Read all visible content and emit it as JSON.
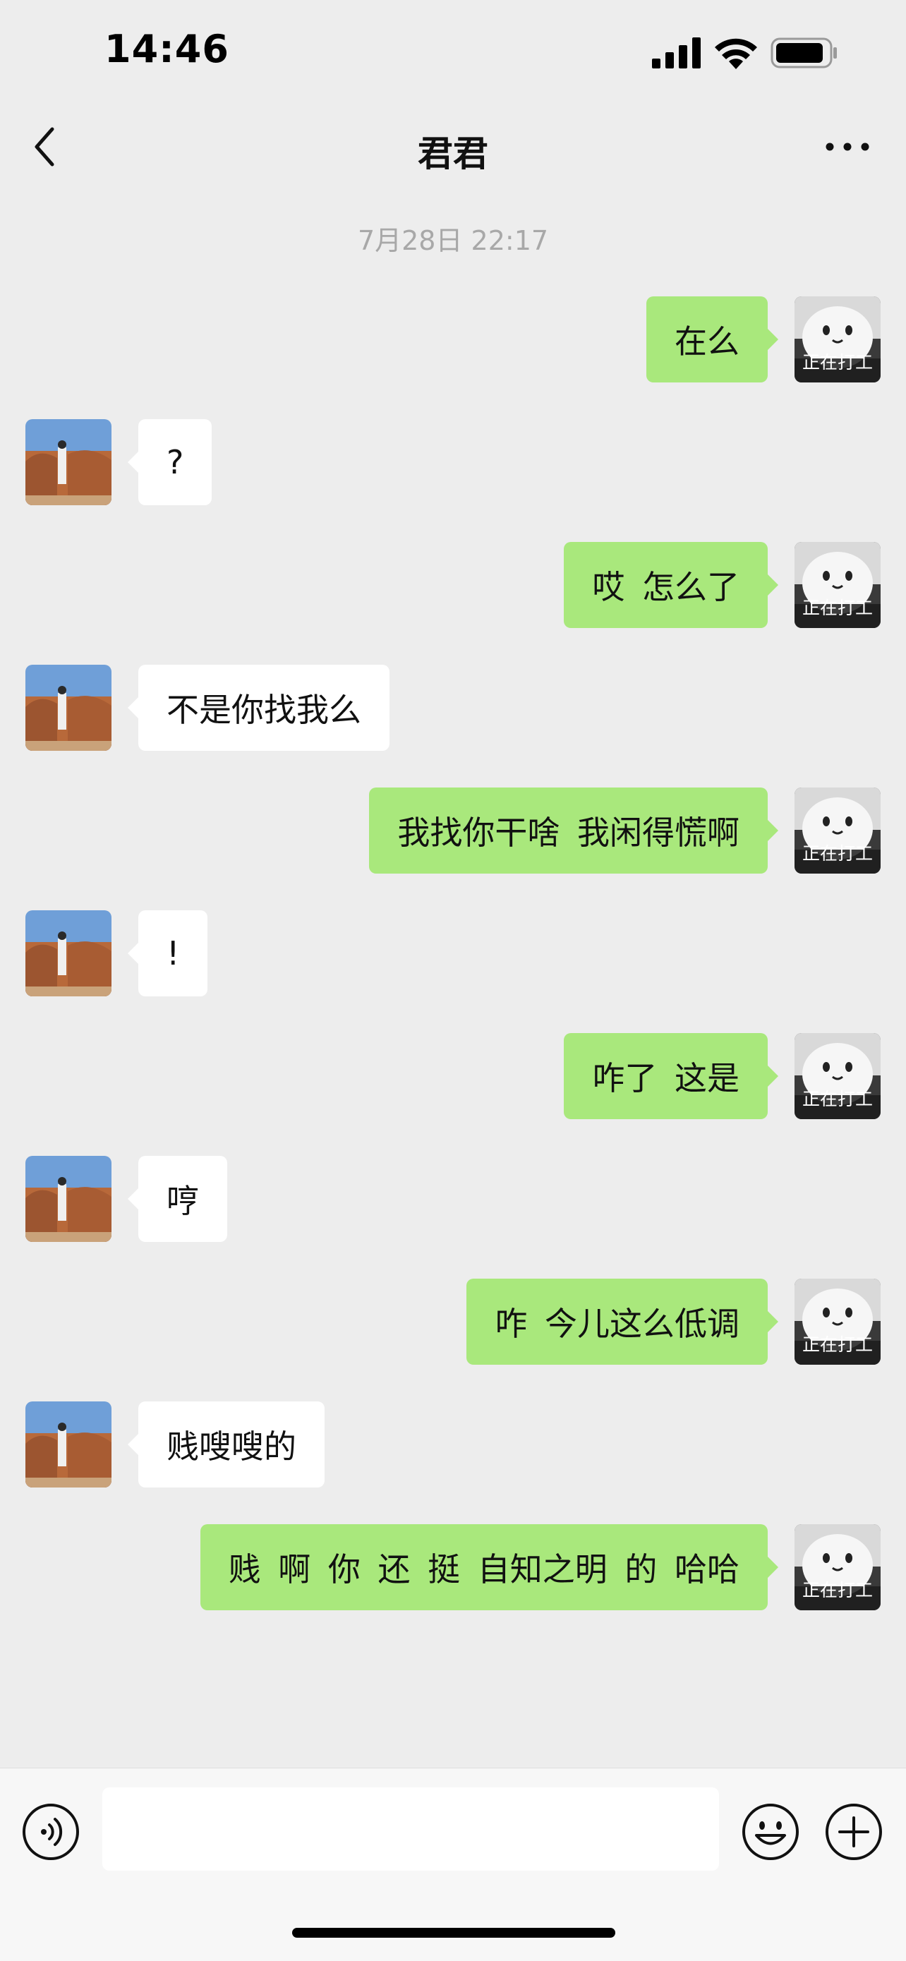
{
  "status_bar": {
    "time": "14:46"
  },
  "nav": {
    "title": "君君",
    "back_icon": "chevron-left-icon",
    "more_icon": "ellipsis-icon"
  },
  "timestamp": "7月28日 22:17",
  "avatars": {
    "me_label": "正在打工",
    "colors": {
      "sent_bubble": "#a9e87c",
      "received_bubble": "#ffffff",
      "background": "#ededed"
    }
  },
  "messages": [
    {
      "from": "me",
      "text": "在么"
    },
    {
      "from": "them",
      "text": "?"
    },
    {
      "from": "me",
      "text": "哎 怎么了"
    },
    {
      "from": "them",
      "text": "不是你找我么"
    },
    {
      "from": "me",
      "text": "我找你干啥 我闲得慌啊"
    },
    {
      "from": "them",
      "text": "!"
    },
    {
      "from": "me",
      "text": "咋了 这是"
    },
    {
      "from": "them",
      "text": "哼"
    },
    {
      "from": "me",
      "text": "咋 今儿这么低调"
    },
    {
      "from": "them",
      "text": "贱嗖嗖的"
    },
    {
      "from": "me",
      "text": "贱 啊 你 还 挺 自知之明 的 哈哈"
    }
  ],
  "input_bar": {
    "value": "",
    "icons": [
      "voice-icon",
      "emoji-icon",
      "plus-icon"
    ]
  }
}
